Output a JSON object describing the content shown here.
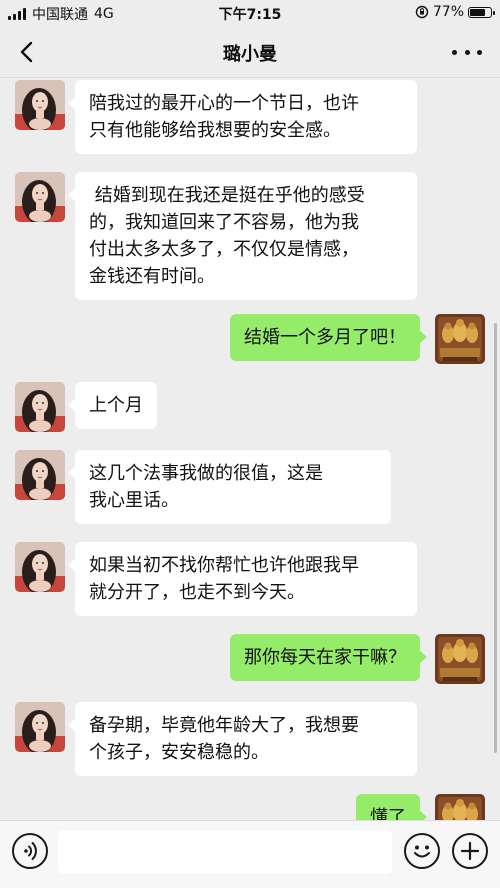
{
  "status_bar": {
    "carrier": "中国联通",
    "network": "4G",
    "time": "下午7:15",
    "battery_percent": 77,
    "battery_label": "77%"
  },
  "header": {
    "title": "璐小曼"
  },
  "messages": [
    {
      "sender": "other",
      "lines": [
        "陪我过的最开心的一个节日，也许",
        "只有他能够给我想要的安全感。"
      ]
    },
    {
      "sender": "other",
      "lines": [
        " 结婚到现在我还是挺在乎他的感受",
        "的，我知道回来了不容易，他为我",
        "付出太多太多了，不仅仅是情感，",
        "金钱还有时间。"
      ]
    },
    {
      "sender": "me",
      "lines": [
        "结婚一个多月了吧！"
      ]
    },
    {
      "sender": "other",
      "lines": [
        "上个月"
      ]
    },
    {
      "sender": "other",
      "lines": [
        "这几个法事我做的很值，这是",
        "我心里话。"
      ]
    },
    {
      "sender": "other",
      "lines": [
        "如果当初不找你帮忙也许他跟我早",
        "就分开了，也走不到今天。"
      ]
    },
    {
      "sender": "me",
      "lines": [
        "那你每天在家干嘛？"
      ]
    },
    {
      "sender": "other",
      "lines": [
        "备孕期，毕竟他年龄大了，我想要",
        "个孩子，安安稳稳的。"
      ]
    },
    {
      "sender": "me",
      "lines": [
        "懂了"
      ]
    }
  ],
  "input_bar": {
    "placeholder": "",
    "icons": [
      "voice-icon",
      "emoji-icon",
      "plus-icon"
    ]
  },
  "colors": {
    "background": "#ededed",
    "my_bubble": "#95ec69",
    "their_bubble": "#ffffff"
  }
}
